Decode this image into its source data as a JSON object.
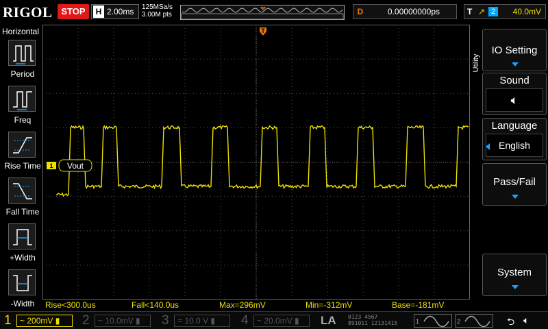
{
  "header": {
    "brand": "RIGOL",
    "run_state": "STOP",
    "horizontal_label": "H",
    "timebase": "2.00ms",
    "sample_rate": "125MSa/s",
    "memory_depth": "3.00M pts",
    "delay_label": "D",
    "delay_value": "0.00000000ps",
    "trigger_label": "T",
    "trigger_source": "2",
    "trigger_level": "40.0mV"
  },
  "left_panel": {
    "title": "Horizontal",
    "items": [
      {
        "label": "Period",
        "icon": "period-icon"
      },
      {
        "label": "Freq",
        "icon": "frequency-icon"
      },
      {
        "label": "Rise Time",
        "icon": "rise-time-icon"
      },
      {
        "label": "Fall Time",
        "icon": "fall-time-icon"
      },
      {
        "label": "+Width",
        "icon": "positive-width-icon"
      },
      {
        "label": "-Width",
        "icon": "negative-width-icon"
      }
    ]
  },
  "waveform": {
    "channel_marker": "1",
    "label": "Vout",
    "color": "#f0e000",
    "trigger_marker": "T"
  },
  "right_menu": {
    "tab": "Utility",
    "io_setting": "IO Setting",
    "sound": "Sound",
    "sound_icon": "speaker-icon",
    "language": "Language",
    "language_value": "English",
    "pass_fail": "Pass/Fail",
    "system": "System"
  },
  "measurements": {
    "rise": "Rise<300.0us",
    "fall": "Fall<140.0us",
    "max": "Max=296mV",
    "min": "Min=-312mV",
    "base": "Base=-181mV"
  },
  "channels": [
    {
      "num": "1",
      "coupling": "~",
      "scale": "200mV",
      "color": "#f0e000"
    },
    {
      "num": "2",
      "coupling": "~",
      "scale": "10.0mV",
      "color": "#555"
    },
    {
      "num": "3",
      "coupling": "=",
      "scale": "10.0 V",
      "color": "#555"
    },
    {
      "num": "4",
      "coupling": "~",
      "scale": "20.0mV",
      "color": "#555"
    }
  ],
  "bottom": {
    "la_label": "LA",
    "digits_row1": "0123 4567",
    "digits_row2": "891011 12131415",
    "gen1": "1",
    "gen2": "2"
  }
}
